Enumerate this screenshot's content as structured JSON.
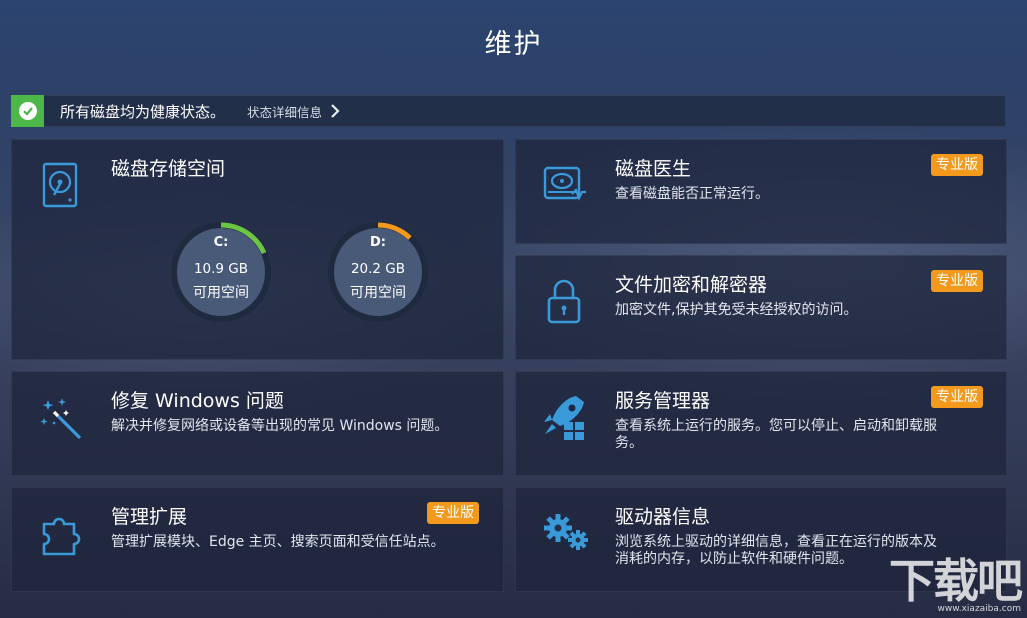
{
  "page": {
    "title": "维护"
  },
  "status": {
    "message": "所有磁盘均为健康状态。",
    "details_link": "状态详细信息"
  },
  "pro_badge": "专业版",
  "colors": {
    "accent": "#3a9ad9",
    "badge": "#f39a1e",
    "healthy": "#4cb848",
    "gauge_c": "#6cc644",
    "gauge_d": "#f39a1e"
  },
  "disk_storage": {
    "title": "磁盘存储空间",
    "icon": "hard-drive-icon",
    "drives": [
      {
        "label": "C:",
        "size": "10.9 GB",
        "free_label": "可用空间"
      },
      {
        "label": "D:",
        "size": "20.2 GB",
        "free_label": "可用空间"
      }
    ]
  },
  "cards": {
    "disk_doctor": {
      "title": "磁盘医生",
      "desc": "查看磁盘能否正常运行。",
      "icon": "disk-health-icon"
    },
    "file_encrypt": {
      "title": "文件加密和解密器",
      "desc": "加密文件,保护其免受未经授权的访问。",
      "icon": "lock-icon"
    },
    "repair_windows": {
      "title": "修复 Windows 问题",
      "desc": "解决并修复网络或设备等出现的常见 Windows 问题。",
      "icon": "magic-wand-icon"
    },
    "service_manager": {
      "title": "服务管理器",
      "desc_line1": "查看系统上运行的服务。您可以停止、启动和卸载服",
      "desc_line2": "务。",
      "icon": "rocket-windows-icon"
    },
    "extensions": {
      "title": "管理扩展",
      "desc": "管理扩展模块、Edge 主页、搜索页面和受信任站点。",
      "icon": "puzzle-icon"
    },
    "driver_info": {
      "title": "驱动器信息",
      "desc_line1": "浏览系统上驱动的详细信息，查看正在运行的版本及",
      "desc_line2": "消耗的内存，以防止软件和硬件问题。",
      "icon": "gears-icon"
    }
  },
  "watermark": {
    "text": "下载吧",
    "url": "www.xiazaiba.com"
  }
}
